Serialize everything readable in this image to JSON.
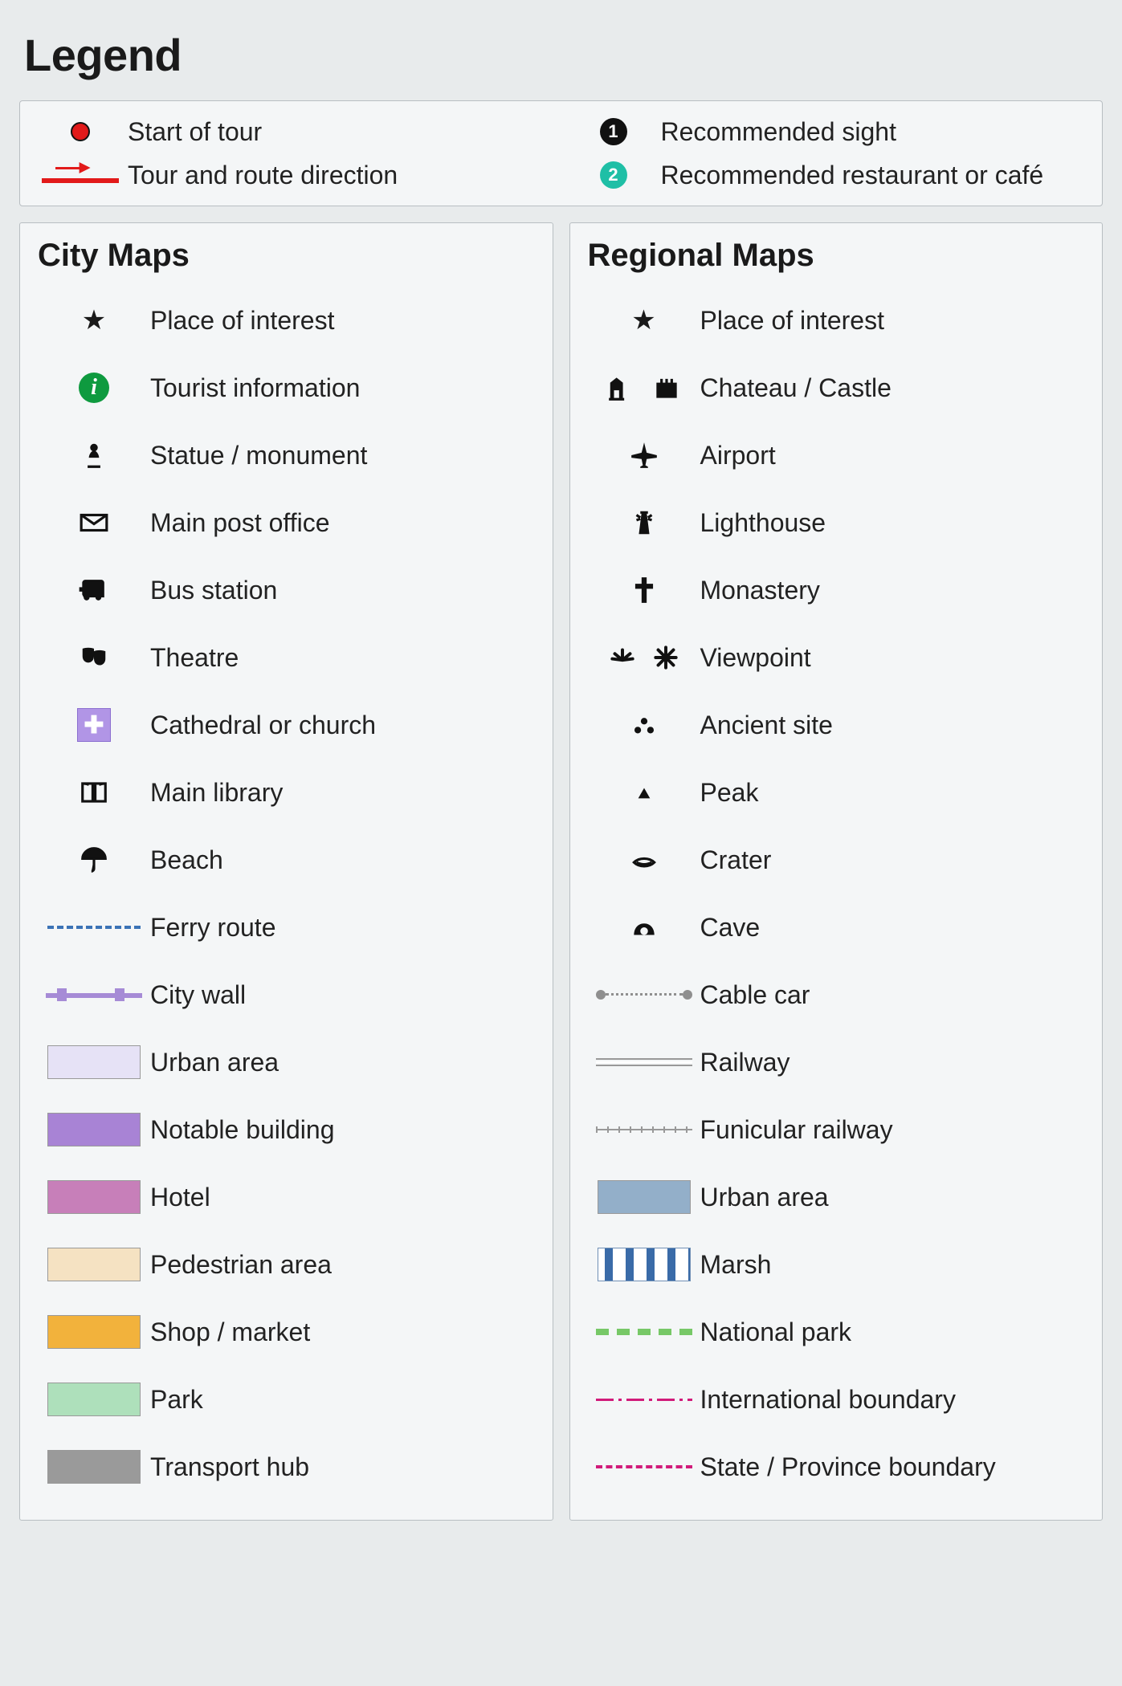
{
  "title": "Legend",
  "top": [
    {
      "icon": "start-dot",
      "label": "Start of tour"
    },
    {
      "icon": "route-arrow",
      "label": "Tour and route direction"
    },
    {
      "icon": "badge-1",
      "label": "Recommended sight"
    },
    {
      "icon": "badge-2",
      "label": "Recommended restaurant or café"
    }
  ],
  "sections": {
    "city": {
      "heading": "City Maps",
      "items": [
        {
          "icon": "star",
          "label": "Place of interest"
        },
        {
          "icon": "info",
          "label": "Tourist information"
        },
        {
          "icon": "statue",
          "label": "Statue / monument"
        },
        {
          "icon": "post",
          "label": "Main post office"
        },
        {
          "icon": "bus",
          "label": "Bus station"
        },
        {
          "icon": "theatre",
          "label": "Theatre"
        },
        {
          "icon": "church",
          "label": "Cathedral or church"
        },
        {
          "icon": "library",
          "label": "Main library"
        },
        {
          "icon": "beach",
          "label": "Beach"
        },
        {
          "icon": "ferry",
          "label": "Ferry route"
        },
        {
          "icon": "citywall",
          "label": "City wall"
        },
        {
          "icon": "swatch",
          "color": "#e6e2f6",
          "label": "Urban area"
        },
        {
          "icon": "swatch",
          "color": "#a883d5",
          "label": "Notable building"
        },
        {
          "icon": "swatch",
          "color": "#c77fb9",
          "label": "Hotel"
        },
        {
          "icon": "swatch",
          "color": "#f5e2c2",
          "label": "Pedestrian area"
        },
        {
          "icon": "swatch",
          "color": "#f2b23c",
          "label": "Shop / market"
        },
        {
          "icon": "swatch",
          "color": "#aee0bb",
          "label": "Park"
        },
        {
          "icon": "swatch",
          "color": "#9a9a9a",
          "label": "Transport hub"
        }
      ]
    },
    "regional": {
      "heading": "Regional Maps",
      "items": [
        {
          "icon": "star",
          "label": "Place of interest"
        },
        {
          "icon": "chateau",
          "label": "Chateau / Castle"
        },
        {
          "icon": "airport",
          "label": "Airport"
        },
        {
          "icon": "lighthouse",
          "label": "Lighthouse"
        },
        {
          "icon": "monastery",
          "label": "Monastery"
        },
        {
          "icon": "viewpoint",
          "label": "Viewpoint"
        },
        {
          "icon": "ancient",
          "label": "Ancient site"
        },
        {
          "icon": "peak",
          "label": "Peak"
        },
        {
          "icon": "crater",
          "label": "Crater"
        },
        {
          "icon": "cave",
          "label": "Cave"
        },
        {
          "icon": "cablecar",
          "label": "Cable car"
        },
        {
          "icon": "railway",
          "label": "Railway"
        },
        {
          "icon": "funicular",
          "label": "Funicular railway"
        },
        {
          "icon": "swatch",
          "color": "#93afc9",
          "label": "Urban area"
        },
        {
          "icon": "marsh",
          "label": "Marsh"
        },
        {
          "icon": "natpark",
          "label": "National park"
        },
        {
          "icon": "intl",
          "label": "International boundary"
        },
        {
          "icon": "stateb",
          "label": "State / Province boundary"
        }
      ]
    }
  },
  "chart_data": null
}
